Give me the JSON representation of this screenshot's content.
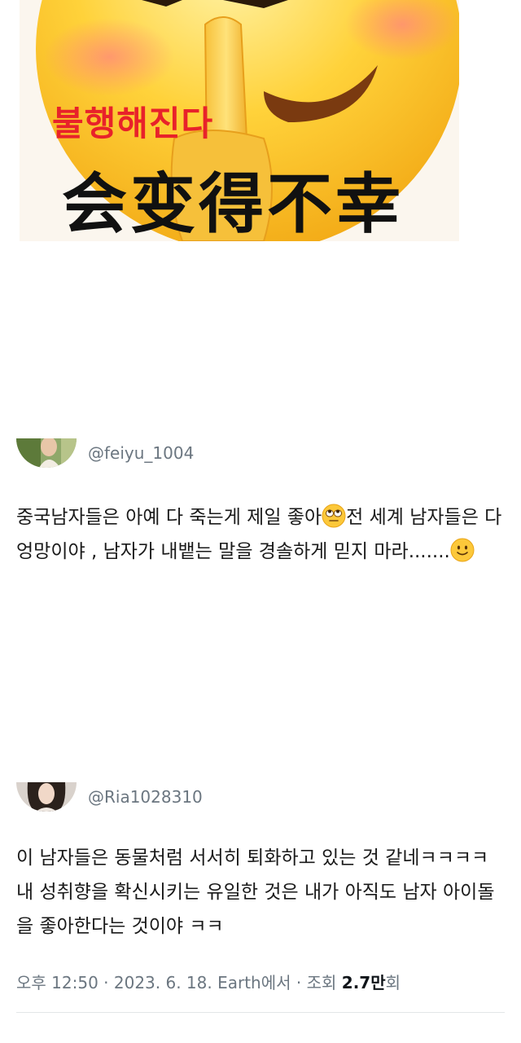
{
  "meme": {
    "caption_korean": "불행해진다",
    "caption_chinese": "会变得不幸"
  },
  "tweets": [
    {
      "handle": "@feiyu_1004",
      "text_1": "중국남자들은 아예 다 죽는게 제일 좋아",
      "emoji_1": "face-with-rolling-eyes-emoji",
      "text_2": "전 세계 남자들은 다 엉망이야 , 남자가 내뱉는 말을 경솔하게 믿지 마라.......",
      "emoji_2": "slightly-smiling-face-emoji"
    },
    {
      "handle": "@Ria1028310",
      "text": "이 남자들은 동물처럼 서서히 퇴화하고 있는 것 같네ㅋㅋㅋㅋ 내 성취향을 확신시키는 유일한 것은 내가 아직도 남자 아이돌을 좋아한다는  것이야 ㅋㅋ"
    }
  ],
  "meta": {
    "time": "오후 12:50",
    "date": "2023. 6. 18.",
    "source": "Earth에서",
    "views_label": "조회",
    "views_count": "2.7만",
    "views_suffix": "회"
  }
}
